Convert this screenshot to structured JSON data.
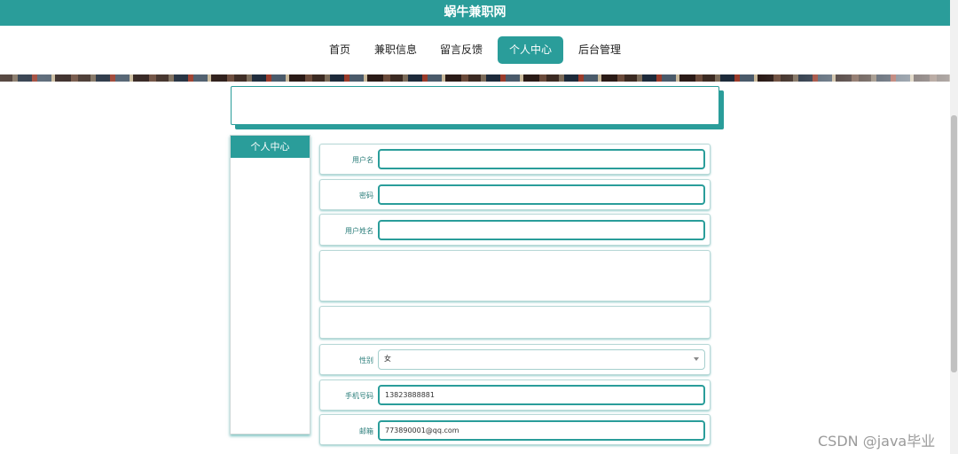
{
  "header": {
    "title": "蜗牛兼职网"
  },
  "nav": {
    "items": [
      {
        "label": "首页",
        "left": 0
      },
      {
        "label": "兼职信息"
      },
      {
        "label": "留言反馈"
      },
      {
        "label": "个人中心"
      },
      {
        "label": "后台管理"
      }
    ]
  },
  "sidebar": {
    "title": "个人中心"
  },
  "form": {
    "username_label": "用户名",
    "username_value": "",
    "password_label": "密码",
    "password_value": "",
    "realname_label": "用户姓名",
    "realname_value": "",
    "gender_label": "性别",
    "gender_value": "女",
    "phone_label": "手机号码",
    "phone_value": "13823888881",
    "email_label": "邮箱",
    "email_value": "773890001@qq.com"
  },
  "watermark": "CSDN @java毕业",
  "colors": {
    "accent": "#2a9d9a"
  }
}
